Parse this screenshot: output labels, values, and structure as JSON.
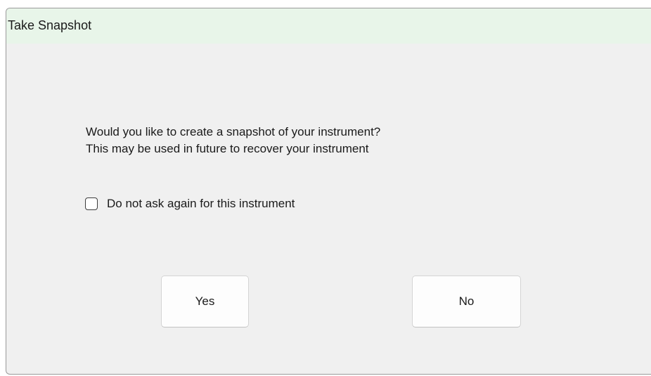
{
  "window": {
    "title": "Take Snapshot"
  },
  "message": {
    "line1": "Would you like to create a snapshot of your instrument?",
    "line2": "This may be used in future to recover your instrument"
  },
  "checkbox": {
    "label": "Do not ask again for this instrument",
    "checked": false
  },
  "buttons": {
    "yes_label": "Yes",
    "no_label": "No"
  },
  "colors": {
    "titlebar_background": "#e8f5e9",
    "dialog_background": "#f0f0f0"
  }
}
